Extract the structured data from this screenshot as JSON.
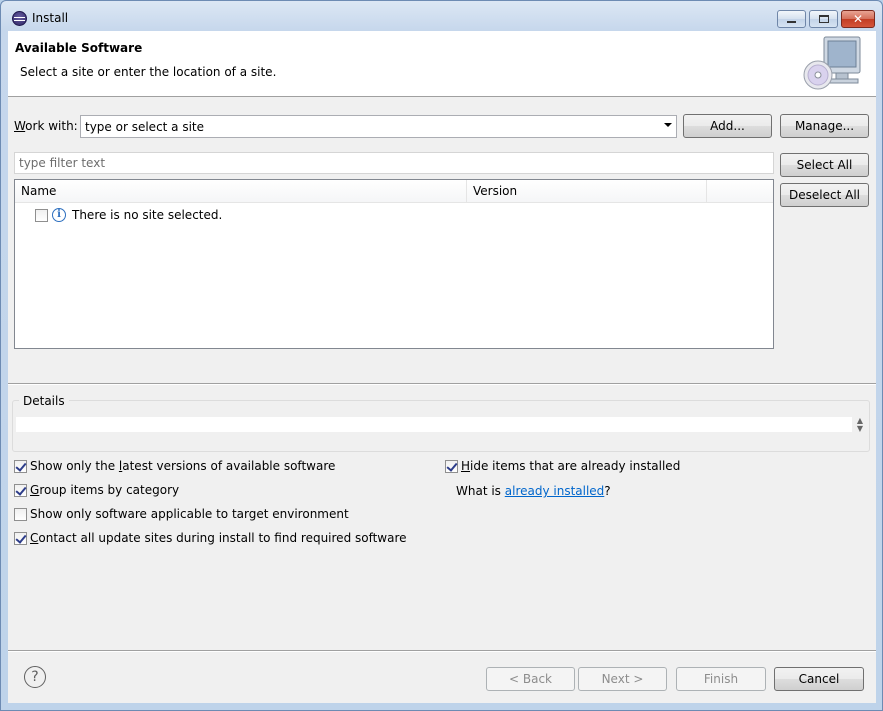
{
  "window": {
    "title": "Install"
  },
  "banner": {
    "title": "Available Software",
    "description": "Select a site or enter the location of a site."
  },
  "work_with": {
    "label_mnemonic": "W",
    "label_rest": "ork with:",
    "combo_value": "type or select a site",
    "add_button": "Add...",
    "manage_button": "Manage..."
  },
  "filter": {
    "placeholder": "type filter text"
  },
  "selection_buttons": {
    "select_all": "Select All",
    "deselect_all": "Deselect All"
  },
  "table": {
    "columns": [
      "Name",
      "Version"
    ],
    "rows": [
      {
        "checked": false,
        "icon": "info-icon",
        "text": "There is no site selected."
      }
    ]
  },
  "details": {
    "label": "Details",
    "text": ""
  },
  "options": {
    "show_latest": {
      "text_pre": "Show only the ",
      "mnemonic": "l",
      "text_post": "atest versions of available software",
      "checked": true
    },
    "group_by_category": {
      "mnemonic": "G",
      "text_post": "roup items by category",
      "checked": true
    },
    "show_applicable": {
      "text": "Show only software applicable to target environment",
      "checked": false
    },
    "contact_sites": {
      "mnemonic": "C",
      "text_post": "ontact all update sites during install to find required software",
      "checked": true
    },
    "hide_installed": {
      "mnemonic": "H",
      "text_post": "ide items that are already installed",
      "checked": true
    },
    "what_is_prefix": "What is ",
    "already_installed_link": "already installed",
    "what_is_suffix": "?"
  },
  "footer": {
    "back": "< Back",
    "next": "Next >",
    "finish": "Finish",
    "cancel": "Cancel"
  },
  "colors": {
    "link": "#0066cc",
    "dialog_bg": "#f0f0f0",
    "info_icon": "#2d6fbf"
  }
}
